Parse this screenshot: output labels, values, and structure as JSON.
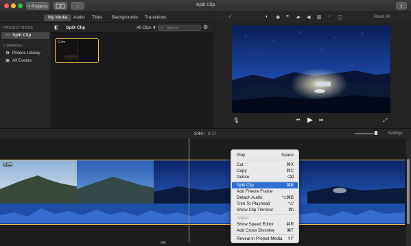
{
  "window": {
    "title": "Split Clip",
    "projects_button": "< Projects",
    "colors": {
      "close": "#ff5f57",
      "minimize": "#ffbd2e",
      "zoom": "#28c840",
      "accent": "#f2c14e",
      "highlight": "#2f6fd6"
    }
  },
  "tabs": {
    "items": [
      {
        "label": "My Media",
        "active": true
      },
      {
        "label": "Audio",
        "active": false
      },
      {
        "label": "Titles",
        "active": false
      },
      {
        "label": "Backgrounds",
        "active": false
      },
      {
        "label": "Transitions",
        "active": false
      }
    ]
  },
  "sidebar": {
    "project_media_header": "PROJECT MEDIA",
    "project_item": "Split Clip",
    "libraries_header": "LIBRARIES",
    "library_items": [
      "Photos Library",
      "All Events"
    ]
  },
  "browser": {
    "title": "Split Clip",
    "filter": "All Clips ⬍",
    "search_placeholder": "Search",
    "thumb_duration": "9.2m"
  },
  "viewer": {
    "reset_all": "Reset All",
    "icons": [
      "magic-wand-icon",
      "color-balance-icon",
      "color-correction-icon",
      "crop-icon",
      "stabilization-icon",
      "volume-icon",
      "noise-reduction-icon",
      "speed-icon",
      "info-icon"
    ]
  },
  "timeline": {
    "current_time": "3:44",
    "total_time": "9:17",
    "settings_label": "Settings",
    "clip_duration": "9.2m"
  },
  "context_menu": {
    "items": [
      {
        "label": "Play",
        "shortcut": "Space",
        "state": "normal"
      },
      {
        "label": "Cut",
        "shortcut": "⌘X",
        "state": "normal"
      },
      {
        "label": "Copy",
        "shortcut": "⌘C",
        "state": "normal"
      },
      {
        "label": "Delete",
        "shortcut": "⌫",
        "state": "normal"
      },
      {
        "label": "Split Clip",
        "shortcut": "⌘B",
        "state": "highlighted"
      },
      {
        "label": "Add Freeze Frame",
        "shortcut": "",
        "state": "normal"
      },
      {
        "label": "Detach Audio",
        "shortcut": "⌥⌘B",
        "state": "normal"
      },
      {
        "label": "Trim To Playhead",
        "shortcut": "⌥/",
        "state": "normal"
      },
      {
        "label": "Show Clip Trimmer",
        "shortcut": "⌘\\",
        "state": "normal"
      },
      {
        "label": "Adjust",
        "shortcut": "",
        "state": "disabled"
      },
      {
        "label": "Show Speed Editor",
        "shortcut": "⌘R",
        "state": "normal"
      },
      {
        "label": "Add Cross Dissolve",
        "shortcut": "⌘T",
        "state": "normal"
      },
      {
        "label": "Reveal in Project Media",
        "shortcut": "⇧F",
        "state": "normal"
      }
    ]
  }
}
